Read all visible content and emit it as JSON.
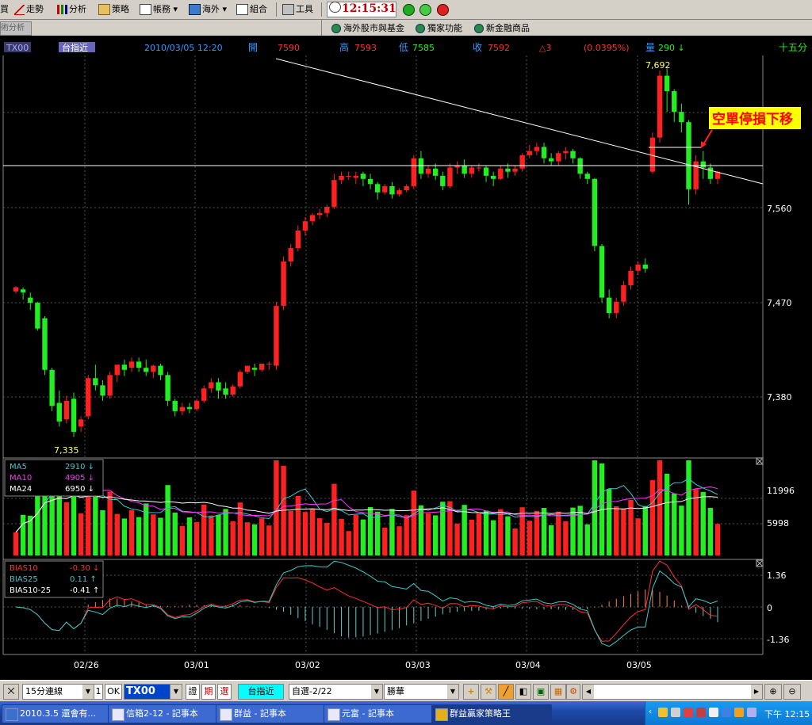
{
  "menubar": {
    "items": [
      {
        "label": "買",
        "icon": "trade-icon"
      },
      {
        "label": "走勢",
        "icon": "trend-icon"
      },
      {
        "label": "分析",
        "icon": "analysis-icon"
      },
      {
        "label": "策略",
        "icon": "strategy-icon"
      },
      {
        "label": "帳務",
        "icon": "account-icon"
      },
      {
        "label": "海外",
        "icon": "overseas-icon"
      },
      {
        "label": "組合",
        "icon": "combo-icon"
      },
      {
        "label": "工具",
        "icon": "tools-icon"
      }
    ],
    "clock": "12:15:31"
  },
  "tabbar": {
    "active_tab": "術分析",
    "links": [
      "海外股市與基金",
      "獨家功能",
      "新金融商品"
    ]
  },
  "chart": {
    "header": {
      "symbol": "TX00",
      "name": "台指近",
      "datetime": "2010/03/05 12:20",
      "open_label": "開",
      "open": "7590",
      "high_label": "高",
      "high": "7593",
      "low_label": "低",
      "low": "7585",
      "close_label": "收",
      "close": "7592",
      "change": "△3",
      "change_pct": "(0.0395%)",
      "vol_label": "量",
      "vol": "290 ↓",
      "period": "十五分"
    },
    "annotation": "空單停損下移",
    "high_marker": "7,692",
    "low_marker": "7,335",
    "colors": {
      "up": "#ff2020",
      "down": "#22ee22",
      "grid": "#555555",
      "axis": "#ffffff",
      "header_blue": "#3399ff",
      "header_red": "#ff3030"
    }
  },
  "chart_data": {
    "type": "candlestick",
    "price_axis_ticks": [
      "7,560",
      "7,470",
      "7,380"
    ],
    "price_range": [
      7320,
      7700
    ],
    "volume_axis_ticks": [
      "11996",
      "5998"
    ],
    "bias_axis_ticks": [
      "1.36",
      "0",
      "-1.36"
    ],
    "x_ticks": [
      "02/26",
      "03/01",
      "03/02",
      "03/03",
      "03/04",
      "03/05"
    ],
    "volume_legend": [
      {
        "name": "MA5",
        "value": "2910 ↓",
        "color": "#33cccc"
      },
      {
        "name": "MA10",
        "value": "4905 ↓",
        "color": "#ff33ff"
      },
      {
        "name": "MA24",
        "value": "6950 ↓",
        "color": "#ffffff"
      }
    ],
    "bias_legend": [
      {
        "name": "BIAS10",
        "value": "-0.30 ↓",
        "color": "#ff3030"
      },
      {
        "name": "BIAS25",
        "value": "0.11 ↑",
        "color": "#33cccc"
      },
      {
        "name": "BIAS10-25",
        "value": "-0.41 ↑",
        "color": "#ffffff"
      }
    ],
    "candles": [
      [
        7476,
        7481,
        7480,
        7474
      ],
      [
        7478,
        7480,
        7475,
        7468
      ],
      [
        7470,
        7475,
        7465,
        7458
      ],
      [
        7465,
        7466,
        7440,
        7438
      ],
      [
        7450,
        7452,
        7400,
        7395
      ],
      [
        7400,
        7402,
        7365,
        7360
      ],
      [
        7368,
        7380,
        7350,
        7345
      ],
      [
        7352,
        7375,
        7370,
        7348
      ],
      [
        7372,
        7378,
        7340,
        7335
      ],
      [
        7345,
        7355,
        7352,
        7340
      ],
      [
        7355,
        7395,
        7392,
        7352
      ],
      [
        7392,
        7405,
        7385,
        7380
      ],
      [
        7385,
        7390,
        7375,
        7370
      ],
      [
        7375,
        7398,
        7395,
        7372
      ],
      [
        7395,
        7402,
        7405,
        7388
      ],
      [
        7405,
        7410,
        7400,
        7394
      ],
      [
        7402,
        7412,
        7408,
        7398
      ],
      [
        7408,
        7412,
        7402,
        7398
      ],
      [
        7402,
        7410,
        7398,
        7394
      ],
      [
        7398,
        7405,
        7404,
        7392
      ],
      [
        7404,
        7406,
        7395,
        7390
      ],
      [
        7395,
        7398,
        7370,
        7365
      ],
      [
        7370,
        7372,
        7360,
        7355
      ],
      [
        7360,
        7368,
        7364,
        7356
      ],
      [
        7364,
        7368,
        7362,
        7358
      ],
      [
        7362,
        7372,
        7370,
        7360
      ],
      [
        7370,
        7385,
        7382,
        7368
      ],
      [
        7382,
        7392,
        7388,
        7378
      ],
      [
        7388,
        7392,
        7380,
        7372
      ],
      [
        7382,
        7388,
        7376,
        7372
      ],
      [
        7376,
        7386,
        7384,
        7374
      ],
      [
        7384,
        7400,
        7398,
        7382
      ],
      [
        7398,
        7404,
        7404,
        7396
      ],
      [
        7402,
        7406,
        7400,
        7394
      ],
      [
        7400,
        7406,
        7406,
        7398
      ],
      [
        7406,
        7408,
        7406,
        7400
      ],
      [
        7404,
        7466,
        7462,
        7400
      ],
      [
        7462,
        7510,
        7505,
        7458
      ],
      [
        7505,
        7522,
        7518,
        7500
      ],
      [
        7518,
        7540,
        7535,
        7515
      ],
      [
        7535,
        7548,
        7544,
        7530
      ],
      [
        7544,
        7552,
        7550,
        7540
      ],
      [
        7550,
        7556,
        7552,
        7546
      ],
      [
        7552,
        7560,
        7558,
        7548
      ],
      [
        7558,
        7590,
        7584,
        7556
      ],
      [
        7584,
        7592,
        7588,
        7580
      ],
      [
        7588,
        7592,
        7588,
        7584
      ],
      [
        7586,
        7592,
        7588,
        7580
      ],
      [
        7590,
        7592,
        7585,
        7578
      ],
      [
        7585,
        7590,
        7580,
        7575
      ],
      [
        7580,
        7582,
        7572,
        7565
      ],
      [
        7572,
        7580,
        7578,
        7570
      ],
      [
        7578,
        7582,
        7570,
        7566
      ],
      [
        7570,
        7576,
        7574,
        7568
      ],
      [
        7574,
        7580,
        7578,
        7572
      ],
      [
        7578,
        7608,
        7605,
        7575
      ],
      [
        7605,
        7612,
        7590,
        7585
      ],
      [
        7590,
        7598,
        7595,
        7586
      ],
      [
        7595,
        7600,
        7588,
        7584
      ],
      [
        7588,
        7592,
        7578,
        7574
      ],
      [
        7578,
        7600,
        7596,
        7576
      ],
      [
        7596,
        7602,
        7598,
        7590
      ],
      [
        7598,
        7604,
        7590,
        7586
      ],
      [
        7590,
        7598,
        7596,
        7586
      ],
      [
        7596,
        7600,
        7596,
        7592
      ],
      [
        7596,
        7598,
        7588,
        7582
      ],
      [
        7588,
        7592,
        7585,
        7578
      ],
      [
        7585,
        7598,
        7595,
        7584
      ],
      [
        7595,
        7600,
        7592,
        7586
      ],
      [
        7592,
        7598,
        7595,
        7588
      ],
      [
        7595,
        7610,
        7608,
        7592
      ],
      [
        7608,
        7618,
        7612,
        7605
      ],
      [
        7612,
        7620,
        7616,
        7608
      ],
      [
        7616,
        7620,
        7605,
        7600
      ],
      [
        7605,
        7610,
        7602,
        7598
      ],
      [
        7602,
        7612,
        7610,
        7598
      ],
      [
        7610,
        7616,
        7612,
        7604
      ],
      [
        7612,
        7614,
        7605,
        7600
      ],
      [
        7605,
        7606,
        7590,
        7585
      ],
      [
        7590,
        7592,
        7585,
        7580
      ],
      [
        7585,
        7586,
        7520,
        7515
      ],
      [
        7520,
        7522,
        7470,
        7465
      ],
      [
        7470,
        7478,
        7455,
        7450
      ],
      [
        7455,
        7470,
        7466,
        7450
      ],
      [
        7466,
        7486,
        7482,
        7462
      ],
      [
        7482,
        7500,
        7496,
        7478
      ],
      [
        7496,
        7505,
        7502,
        7492
      ],
      [
        7502,
        7508,
        7498,
        7494
      ],
      [
        7592,
        7630,
        7625,
        7590
      ],
      [
        7625,
        7690,
        7685,
        7620
      ],
      [
        7685,
        7692,
        7670,
        7650
      ],
      [
        7670,
        7672,
        7650,
        7640
      ],
      [
        7650,
        7658,
        7640,
        7630
      ],
      [
        7640,
        7642,
        7575,
        7560
      ],
      [
        7575,
        7608,
        7602,
        7570
      ],
      [
        7602,
        7612,
        7596,
        7585
      ],
      [
        7596,
        7600,
        7585,
        7580
      ],
      [
        7585,
        7593,
        7592,
        7580
      ]
    ]
  },
  "bottom": {
    "period_select": "15分連線",
    "count": "1",
    "ok": "OK",
    "symbol_input": "TX00",
    "btn_zheng": "證",
    "btn_qi": "期",
    "btn_xuan": "選",
    "name_display": "台指近",
    "watchlist_select": "自選-2/22",
    "indicator_select": "勝華"
  },
  "taskbar": {
    "items": [
      {
        "label": "2010.3.5 還會有..."
      },
      {
        "label": "信箱2-12 - 記事本"
      },
      {
        "label": "群益 - 記事本"
      },
      {
        "label": "元富 - 記事本"
      },
      {
        "label": "群益贏家策略王"
      }
    ],
    "clock": "下午 12:15"
  }
}
